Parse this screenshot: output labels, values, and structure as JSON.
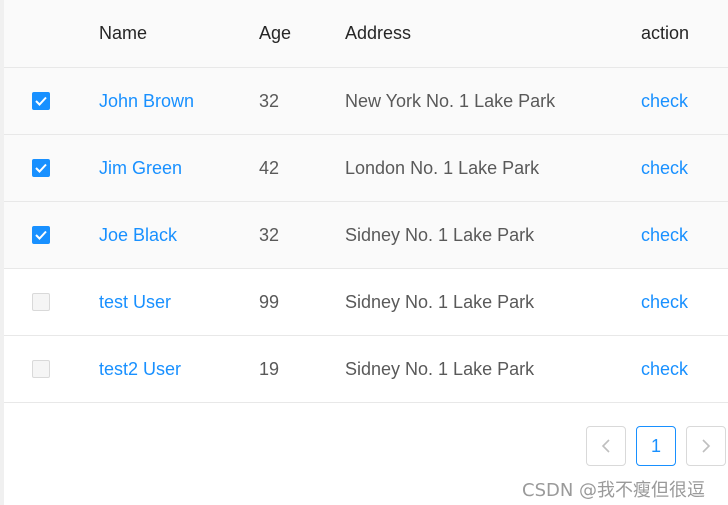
{
  "table": {
    "columns": {
      "name": "Name",
      "age": "Age",
      "address": "Address",
      "action": "action"
    },
    "rows": [
      {
        "name": "John Brown",
        "age": "32",
        "address": "New York No. 1 Lake Park",
        "action": "check",
        "checked": true
      },
      {
        "name": "Jim Green",
        "age": "42",
        "address": "London No. 1 Lake Park",
        "action": "check",
        "checked": true
      },
      {
        "name": "Joe Black",
        "age": "32",
        "address": "Sidney No. 1 Lake Park",
        "action": "check",
        "checked": true
      },
      {
        "name": "test User",
        "age": "99",
        "address": "Sidney No. 1 Lake Park",
        "action": "check",
        "checked": false
      },
      {
        "name": "test2 User",
        "age": "19",
        "address": "Sidney No. 1 Lake Park",
        "action": "check",
        "checked": false
      }
    ]
  },
  "pagination": {
    "prev_icon": "chevron-left-icon",
    "current_page": "1",
    "next_icon": "chevron-right-icon"
  },
  "watermark": {
    "text": "CSDN @我不瘦但很逗"
  },
  "colors": {
    "accent": "#1890ff",
    "header_bg": "#fafafa",
    "border": "#e8e8e8"
  }
}
